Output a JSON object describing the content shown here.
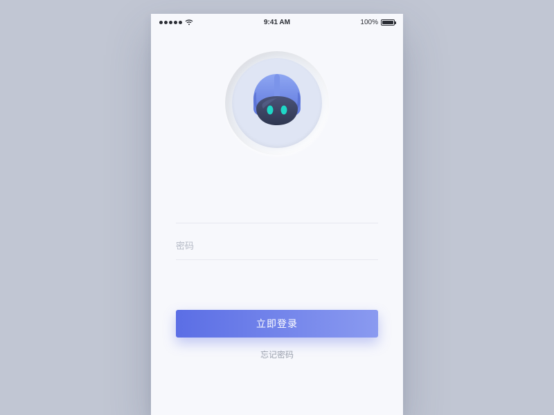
{
  "statusbar": {
    "time": "9:41 AM",
    "battery_pct": "100%"
  },
  "fields": {
    "username": {
      "value": ""
    },
    "password": {
      "placeholder": "密码",
      "value": ""
    }
  },
  "actions": {
    "login_label": "立即登录",
    "forgot_label": "忘记密码"
  },
  "avatar": {
    "kind": "robot-astronaut",
    "accent": "#637de8",
    "visor": "#3a4160",
    "eye": "#1fd7c7"
  }
}
